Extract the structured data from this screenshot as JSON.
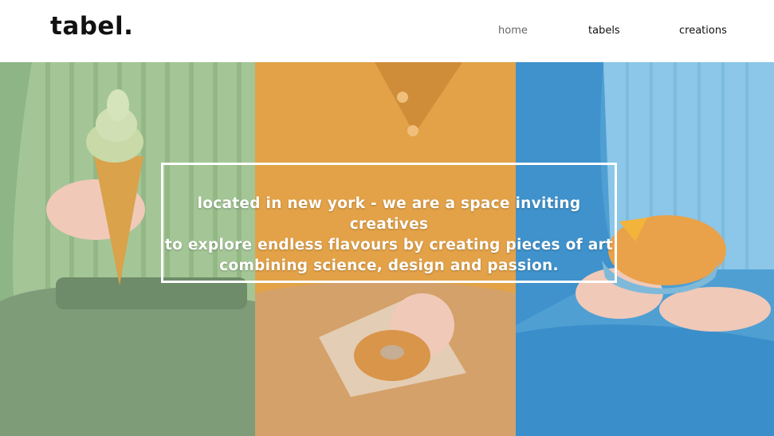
{
  "brand": {
    "logo": "tabel."
  },
  "nav": {
    "items": [
      "home",
      "tabels",
      "creations"
    ]
  },
  "hero": {
    "caption_lines": [
      "located in new york - we are a space inviting creatives",
      "to explore endless flavours by creating pieces of art",
      "combining science, design and passion."
    ]
  },
  "colors": {
    "green": "#8bb083",
    "orange": "#d99b4c",
    "blue": "#56a6d8",
    "text": "#111111",
    "nav_active": "#666666"
  }
}
